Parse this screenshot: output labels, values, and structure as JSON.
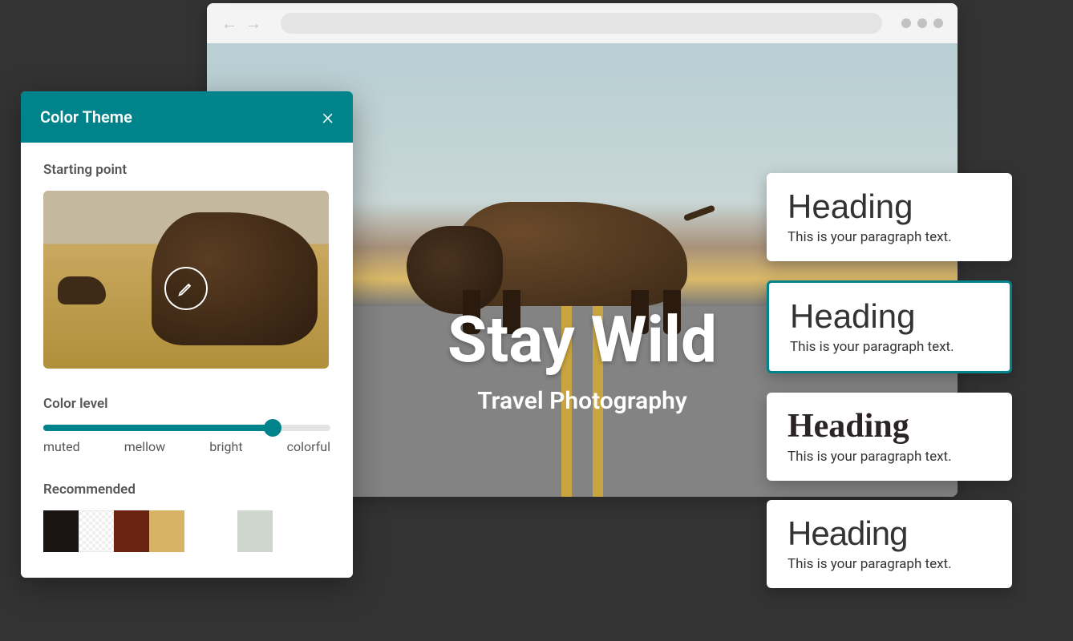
{
  "panel": {
    "title": "Color Theme",
    "starting_label": "Starting point",
    "level_label": "Color level",
    "level_ticks": [
      "muted",
      "mellow",
      "bright",
      "colorful"
    ],
    "recommended_label": "Recommended",
    "swatches": [
      "#1a1512",
      "transparent-pattern",
      "#6a2310",
      "#d6b365",
      "#cfd6cd"
    ]
  },
  "hero": {
    "title": "Stay Wild",
    "subtitle": "Travel Photography"
  },
  "typo_cards": [
    {
      "heading": "Heading",
      "paragraph": "This is your paragraph text.",
      "selected": false
    },
    {
      "heading": "Heading",
      "paragraph": "This is your paragraph text.",
      "selected": true
    },
    {
      "heading": "Heading",
      "paragraph": "This is your paragraph text.",
      "selected": false
    },
    {
      "heading": "Heading",
      "paragraph": "This is your paragraph text.",
      "selected": false
    }
  ]
}
